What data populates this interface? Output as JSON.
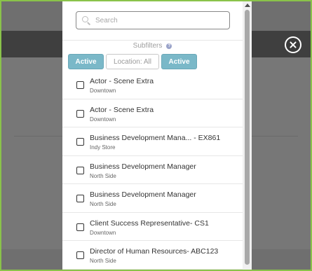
{
  "search": {
    "placeholder": "Search",
    "value": ""
  },
  "subfilters": {
    "label": "Subfilters",
    "help": "?"
  },
  "chips": [
    {
      "label": "Active",
      "state": "active"
    },
    {
      "label": "Location: All",
      "state": "inactive"
    },
    {
      "label": "Active",
      "state": "active"
    }
  ],
  "items": [
    {
      "title": "Actor - Scene Extra",
      "location": "Downtown"
    },
    {
      "title": "Actor - Scene Extra",
      "location": "Downtown"
    },
    {
      "title": "Business Development Mana... - EX861",
      "location": "Indy Store"
    },
    {
      "title": "Business Development Manager",
      "location": "North Side"
    },
    {
      "title": "Business Development Manager",
      "location": "North Side"
    },
    {
      "title": "Client Success Representative- CS1",
      "location": "Downtown"
    },
    {
      "title": "Director of Human Resources- ABC123",
      "location": "North Side"
    }
  ],
  "colors": {
    "accent": "#7ab8c8",
    "frame": "#8ac34a",
    "overlay": "#6f6f6f"
  }
}
